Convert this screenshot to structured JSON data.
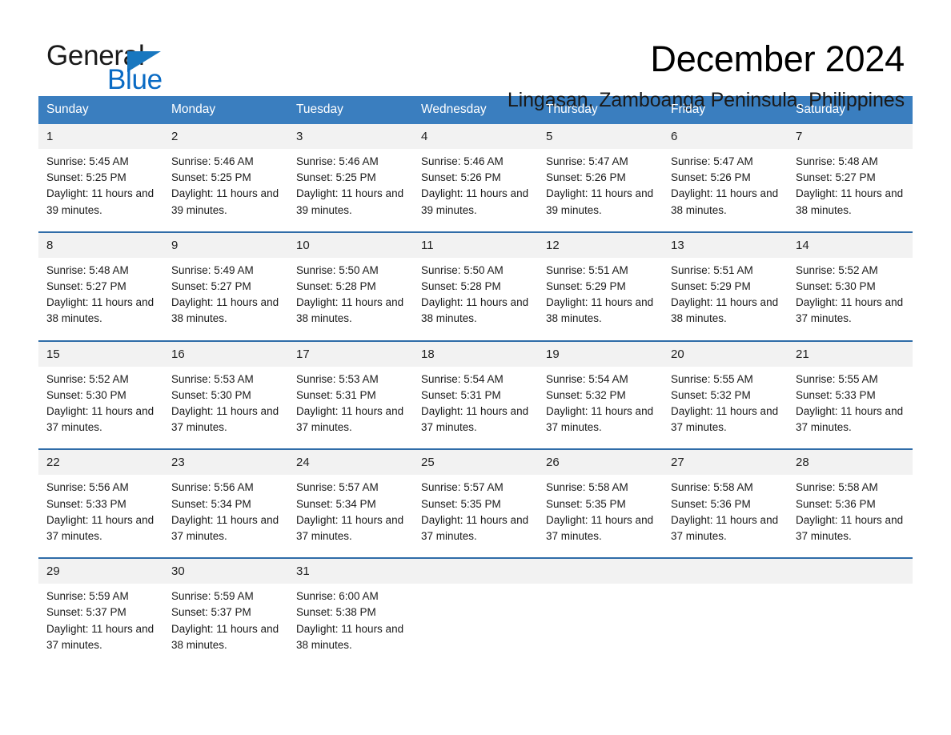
{
  "brand": {
    "name_part1": "General",
    "name_part2": "Blue",
    "accent_color": "#1877bf"
  },
  "header": {
    "month_title": "December 2024",
    "location": "Lingasan, Zamboanga Peninsula, Philippines"
  },
  "calendar": {
    "header_bg": "#3a7ebf",
    "daynum_bg": "#f2f2f2",
    "divider_color": "#2f6ca8",
    "weekdays": [
      "Sunday",
      "Monday",
      "Tuesday",
      "Wednesday",
      "Thursday",
      "Friday",
      "Saturday"
    ],
    "labels": {
      "sunrise_prefix": "Sunrise: ",
      "sunset_prefix": "Sunset: ",
      "daylight_prefix": "Daylight: "
    },
    "weeks": [
      [
        {
          "day": "1",
          "sunrise": "Sunrise: 5:45 AM",
          "sunset": "Sunset: 5:25 PM",
          "daylight": "Daylight: 11 hours and 39 minutes."
        },
        {
          "day": "2",
          "sunrise": "Sunrise: 5:46 AM",
          "sunset": "Sunset: 5:25 PM",
          "daylight": "Daylight: 11 hours and 39 minutes."
        },
        {
          "day": "3",
          "sunrise": "Sunrise: 5:46 AM",
          "sunset": "Sunset: 5:25 PM",
          "daylight": "Daylight: 11 hours and 39 minutes."
        },
        {
          "day": "4",
          "sunrise": "Sunrise: 5:46 AM",
          "sunset": "Sunset: 5:26 PM",
          "daylight": "Daylight: 11 hours and 39 minutes."
        },
        {
          "day": "5",
          "sunrise": "Sunrise: 5:47 AM",
          "sunset": "Sunset: 5:26 PM",
          "daylight": "Daylight: 11 hours and 39 minutes."
        },
        {
          "day": "6",
          "sunrise": "Sunrise: 5:47 AM",
          "sunset": "Sunset: 5:26 PM",
          "daylight": "Daylight: 11 hours and 38 minutes."
        },
        {
          "day": "7",
          "sunrise": "Sunrise: 5:48 AM",
          "sunset": "Sunset: 5:27 PM",
          "daylight": "Daylight: 11 hours and 38 minutes."
        }
      ],
      [
        {
          "day": "8",
          "sunrise": "Sunrise: 5:48 AM",
          "sunset": "Sunset: 5:27 PM",
          "daylight": "Daylight: 11 hours and 38 minutes."
        },
        {
          "day": "9",
          "sunrise": "Sunrise: 5:49 AM",
          "sunset": "Sunset: 5:27 PM",
          "daylight": "Daylight: 11 hours and 38 minutes."
        },
        {
          "day": "10",
          "sunrise": "Sunrise: 5:50 AM",
          "sunset": "Sunset: 5:28 PM",
          "daylight": "Daylight: 11 hours and 38 minutes."
        },
        {
          "day": "11",
          "sunrise": "Sunrise: 5:50 AM",
          "sunset": "Sunset: 5:28 PM",
          "daylight": "Daylight: 11 hours and 38 minutes."
        },
        {
          "day": "12",
          "sunrise": "Sunrise: 5:51 AM",
          "sunset": "Sunset: 5:29 PM",
          "daylight": "Daylight: 11 hours and 38 minutes."
        },
        {
          "day": "13",
          "sunrise": "Sunrise: 5:51 AM",
          "sunset": "Sunset: 5:29 PM",
          "daylight": "Daylight: 11 hours and 38 minutes."
        },
        {
          "day": "14",
          "sunrise": "Sunrise: 5:52 AM",
          "sunset": "Sunset: 5:30 PM",
          "daylight": "Daylight: 11 hours and 37 minutes."
        }
      ],
      [
        {
          "day": "15",
          "sunrise": "Sunrise: 5:52 AM",
          "sunset": "Sunset: 5:30 PM",
          "daylight": "Daylight: 11 hours and 37 minutes."
        },
        {
          "day": "16",
          "sunrise": "Sunrise: 5:53 AM",
          "sunset": "Sunset: 5:30 PM",
          "daylight": "Daylight: 11 hours and 37 minutes."
        },
        {
          "day": "17",
          "sunrise": "Sunrise: 5:53 AM",
          "sunset": "Sunset: 5:31 PM",
          "daylight": "Daylight: 11 hours and 37 minutes."
        },
        {
          "day": "18",
          "sunrise": "Sunrise: 5:54 AM",
          "sunset": "Sunset: 5:31 PM",
          "daylight": "Daylight: 11 hours and 37 minutes."
        },
        {
          "day": "19",
          "sunrise": "Sunrise: 5:54 AM",
          "sunset": "Sunset: 5:32 PM",
          "daylight": "Daylight: 11 hours and 37 minutes."
        },
        {
          "day": "20",
          "sunrise": "Sunrise: 5:55 AM",
          "sunset": "Sunset: 5:32 PM",
          "daylight": "Daylight: 11 hours and 37 minutes."
        },
        {
          "day": "21",
          "sunrise": "Sunrise: 5:55 AM",
          "sunset": "Sunset: 5:33 PM",
          "daylight": "Daylight: 11 hours and 37 minutes."
        }
      ],
      [
        {
          "day": "22",
          "sunrise": "Sunrise: 5:56 AM",
          "sunset": "Sunset: 5:33 PM",
          "daylight": "Daylight: 11 hours and 37 minutes."
        },
        {
          "day": "23",
          "sunrise": "Sunrise: 5:56 AM",
          "sunset": "Sunset: 5:34 PM",
          "daylight": "Daylight: 11 hours and 37 minutes."
        },
        {
          "day": "24",
          "sunrise": "Sunrise: 5:57 AM",
          "sunset": "Sunset: 5:34 PM",
          "daylight": "Daylight: 11 hours and 37 minutes."
        },
        {
          "day": "25",
          "sunrise": "Sunrise: 5:57 AM",
          "sunset": "Sunset: 5:35 PM",
          "daylight": "Daylight: 11 hours and 37 minutes."
        },
        {
          "day": "26",
          "sunrise": "Sunrise: 5:58 AM",
          "sunset": "Sunset: 5:35 PM",
          "daylight": "Daylight: 11 hours and 37 minutes."
        },
        {
          "day": "27",
          "sunrise": "Sunrise: 5:58 AM",
          "sunset": "Sunset: 5:36 PM",
          "daylight": "Daylight: 11 hours and 37 minutes."
        },
        {
          "day": "28",
          "sunrise": "Sunrise: 5:58 AM",
          "sunset": "Sunset: 5:36 PM",
          "daylight": "Daylight: 11 hours and 37 minutes."
        }
      ],
      [
        {
          "day": "29",
          "sunrise": "Sunrise: 5:59 AM",
          "sunset": "Sunset: 5:37 PM",
          "daylight": "Daylight: 11 hours and 37 minutes."
        },
        {
          "day": "30",
          "sunrise": "Sunrise: 5:59 AM",
          "sunset": "Sunset: 5:37 PM",
          "daylight": "Daylight: 11 hours and 38 minutes."
        },
        {
          "day": "31",
          "sunrise": "Sunrise: 6:00 AM",
          "sunset": "Sunset: 5:38 PM",
          "daylight": "Daylight: 11 hours and 38 minutes."
        },
        {
          "day": "",
          "sunrise": "",
          "sunset": "",
          "daylight": ""
        },
        {
          "day": "",
          "sunrise": "",
          "sunset": "",
          "daylight": ""
        },
        {
          "day": "",
          "sunrise": "",
          "sunset": "",
          "daylight": ""
        },
        {
          "day": "",
          "sunrise": "",
          "sunset": "",
          "daylight": ""
        }
      ]
    ]
  }
}
